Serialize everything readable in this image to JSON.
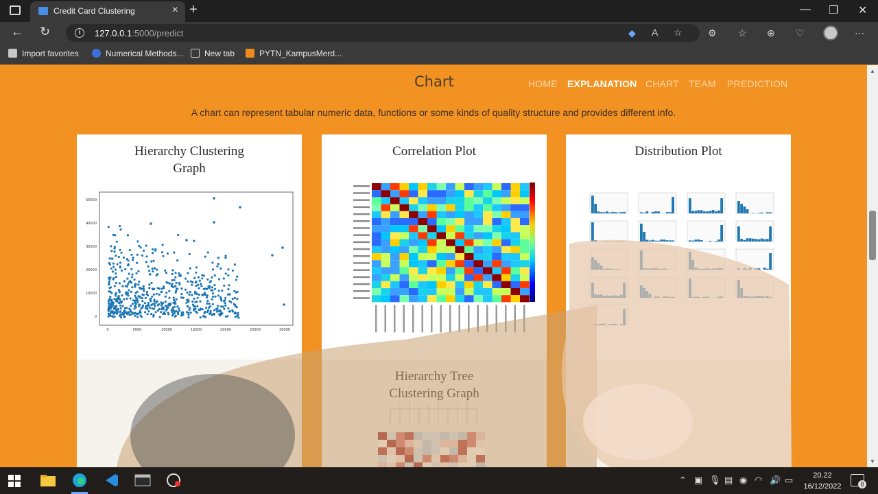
{
  "browser": {
    "tab_title": "Credit Card Clustering",
    "url_host": "127.0.0.1",
    "url_path": ":5000/predict",
    "favorites": [
      "Import favorites",
      "Numerical Methods...",
      "New tab",
      "PYTN_KampusMerd..."
    ]
  },
  "site": {
    "brand": "Chart",
    "nav": [
      "HOME",
      "EXPLANATION",
      "CHART",
      "TEAM",
      "PREDICTION"
    ],
    "active_nav": "EXPLANATION",
    "lead": "A chart can represent tabular numeric data, functions or some kinds of quality structure and provides different info."
  },
  "cards": {
    "hierarchy": "Hierarchy Clustering Graph",
    "correlation": "Correlation Plot",
    "distribution": "Distribution Plot",
    "tree": "Hierarchy Tree Clustering Graph"
  },
  "scatter": {
    "yticks": [
      "50000",
      "40000",
      "30000",
      "20000",
      "10000",
      "0"
    ],
    "xticks": [
      "0",
      "5000",
      "10000",
      "15000",
      "20000",
      "25000",
      "30000"
    ],
    "color": "#1f77b4"
  },
  "taskbar": {
    "time": "20.22",
    "date": "16/12/2022",
    "notifications": "8"
  }
}
